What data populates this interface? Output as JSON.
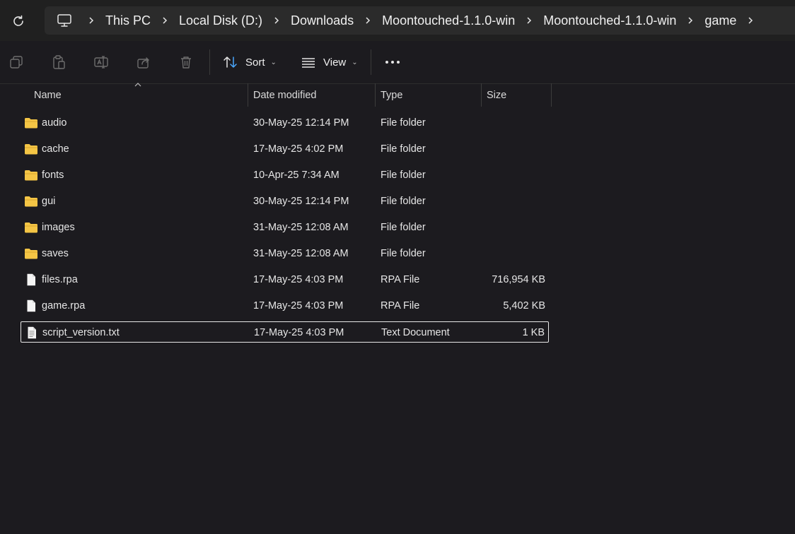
{
  "breadcrumb": [
    "This PC",
    "Local Disk (D:)",
    "Downloads",
    "Moontouched-1.1.0-win",
    "Moontouched-1.1.0-win",
    "game"
  ],
  "toolbar": {
    "sort_label": "Sort",
    "view_label": "View"
  },
  "columns": {
    "name": "Name",
    "date": "Date modified",
    "type": "Type",
    "size": "Size"
  },
  "files": [
    {
      "name": "audio",
      "date": "30-May-25 12:14 PM",
      "type": "File folder",
      "size": "",
      "kind": "folder"
    },
    {
      "name": "cache",
      "date": "17-May-25 4:02 PM",
      "type": "File folder",
      "size": "",
      "kind": "folder"
    },
    {
      "name": "fonts",
      "date": "10-Apr-25 7:34 AM",
      "type": "File folder",
      "size": "",
      "kind": "folder"
    },
    {
      "name": "gui",
      "date": "30-May-25 12:14 PM",
      "type": "File folder",
      "size": "",
      "kind": "folder"
    },
    {
      "name": "images",
      "date": "31-May-25 12:08 AM",
      "type": "File folder",
      "size": "",
      "kind": "folder"
    },
    {
      "name": "saves",
      "date": "31-May-25 12:08 AM",
      "type": "File folder",
      "size": "",
      "kind": "folder"
    },
    {
      "name": "files.rpa",
      "date": "17-May-25 4:03 PM",
      "type": "RPA File",
      "size": "716,954 KB",
      "kind": "file"
    },
    {
      "name": "game.rpa",
      "date": "17-May-25 4:03 PM",
      "type": "RPA File",
      "size": "5,402 KB",
      "kind": "file"
    },
    {
      "name": "script_version.txt",
      "date": "17-May-25 4:03 PM",
      "type": "Text Document",
      "size": "1 KB",
      "kind": "text",
      "selected": true
    }
  ],
  "colors": {
    "background": "#1c1b1f",
    "folder": "#f4c545",
    "selection_border": "#e8e8e8"
  }
}
